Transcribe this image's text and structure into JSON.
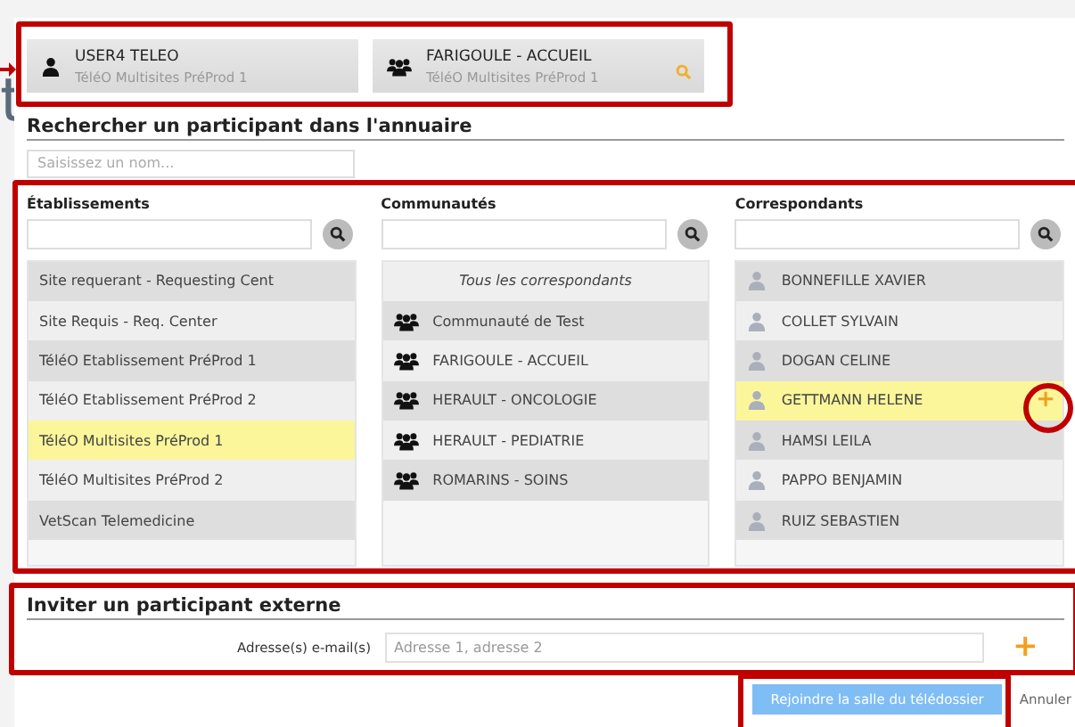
{
  "fragment": "t",
  "participants": [
    {
      "kind": "user",
      "name": "USER4 TELEO",
      "site": "TéléO Multisites PréProd 1"
    },
    {
      "kind": "group",
      "name": "FARIGOULE - ACCUEIL",
      "site": "TéléO Multisites PréProd 1"
    }
  ],
  "directory": {
    "title": "Rechercher un participant dans l'annuaire",
    "search": {
      "placeholder": "Saisissez un nom..."
    }
  },
  "columns": [
    {
      "title": "Établissements",
      "items": [
        {
          "kind": "plain",
          "label": "Site requerant - Requesting Cent",
          "selected": false
        },
        {
          "kind": "plain",
          "label": "Site Requis - Req. Center",
          "selected": false
        },
        {
          "kind": "plain",
          "label": "TéléO Etablissement PréProd 1",
          "selected": false
        },
        {
          "kind": "plain",
          "label": "TéléO Etablissement PréProd 2",
          "selected": false
        },
        {
          "kind": "plain",
          "label": "TéléO Multisites PréProd 1",
          "selected": true
        },
        {
          "kind": "plain",
          "label": "TéléO Multisites PréProd 2",
          "selected": false
        },
        {
          "kind": "plain",
          "label": "VetScan Telemedicine",
          "selected": false
        }
      ]
    },
    {
      "title": "Communautés",
      "items": [
        {
          "kind": "all",
          "label": "Tous les correspondants",
          "selected": false
        },
        {
          "kind": "group",
          "label": "Communauté de Test",
          "selected": false
        },
        {
          "kind": "group",
          "label": "FARIGOULE - ACCUEIL",
          "selected": false
        },
        {
          "kind": "group",
          "label": "HERAULT - ONCOLOGIE",
          "selected": false
        },
        {
          "kind": "group",
          "label": "HERAULT - PEDIATRIE",
          "selected": false
        },
        {
          "kind": "group",
          "label": "ROMARINS - SOINS",
          "selected": false
        }
      ]
    },
    {
      "title": "Correspondants",
      "items": [
        {
          "kind": "person",
          "label": "BONNEFILLE XAVIER",
          "selected": false
        },
        {
          "kind": "person",
          "label": "COLLET SYLVAIN",
          "selected": false
        },
        {
          "kind": "person",
          "label": "DOGAN CELINE",
          "selected": false
        },
        {
          "kind": "person",
          "label": "GETTMANN HELENE",
          "selected": true,
          "add": "+"
        },
        {
          "kind": "person",
          "label": "HAMSI LEILA",
          "selected": false
        },
        {
          "kind": "person",
          "label": "PAPPO BENJAMIN",
          "selected": false
        },
        {
          "kind": "person",
          "label": "RUIZ SEBASTIEN",
          "selected": false
        }
      ]
    }
  ],
  "external": {
    "title": "Inviter un participant externe",
    "email_label": "Adresse(s) e-mail(s)",
    "email": {
      "placeholder": "Adresse 1, adresse 2"
    },
    "add": "+"
  },
  "actions": {
    "join": "Rejoindre la salle du télédossier",
    "cancel": "Annuler"
  }
}
